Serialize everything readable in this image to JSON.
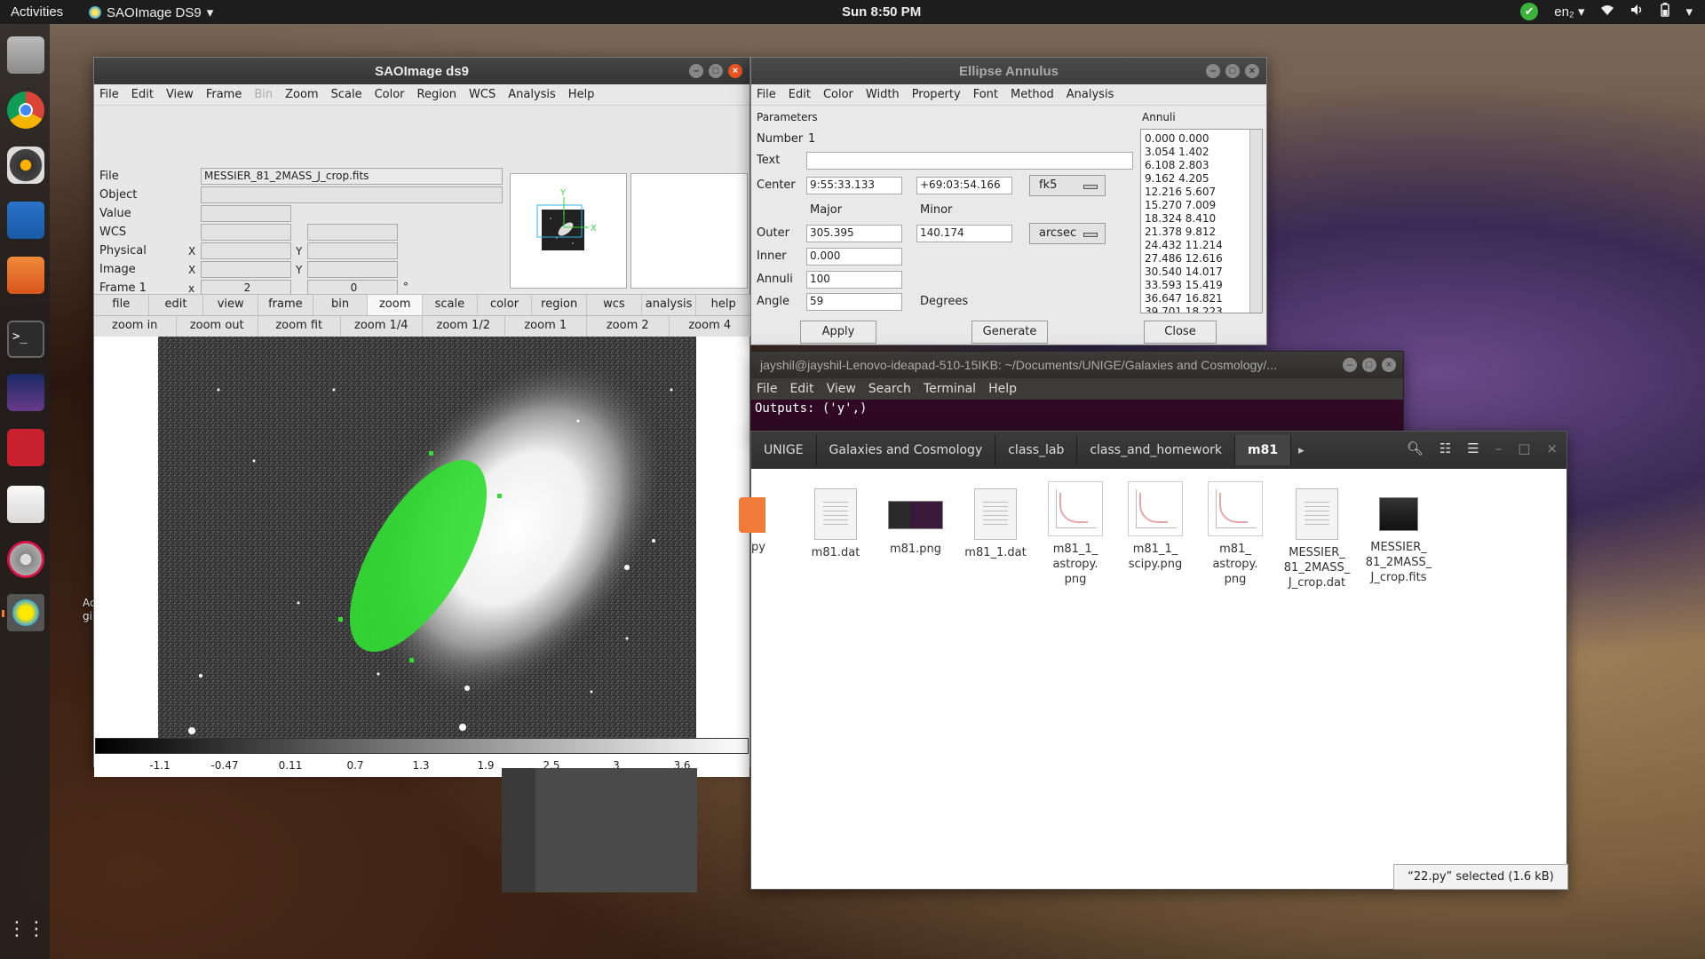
{
  "topbar": {
    "activities": "Activities",
    "app_name": "SAOImage DS9",
    "app_menu_arrow": "▾",
    "clock": "Sun  8:50 PM",
    "lang": "en₂",
    "lang_arrow": "▾"
  },
  "dock": {
    "items": [
      "files-icon",
      "chrome-icon",
      "rhythmbox-icon",
      "writer-icon",
      "software-center-icon",
      "terminal-icon",
      "stellarium-icon",
      "mendeley-icon",
      "text-editor-icon",
      "settings-icon",
      "ds9-icon"
    ],
    "show_apps": "show-applications-icon"
  },
  "desktop": {
    "partial_label": "Ac\ngi"
  },
  "ds9": {
    "title": "SAOImage ds9",
    "menu": [
      "File",
      "Edit",
      "View",
      "Frame",
      "Bin",
      "Zoom",
      "Scale",
      "Color",
      "Region",
      "WCS",
      "Analysis",
      "Help"
    ],
    "info": {
      "file_label": "File",
      "file_value": "MESSIER_81_2MASS_J_crop.fits",
      "object_label": "Object",
      "value_label": "Value",
      "wcs_label": "WCS",
      "physical_label": "Physical",
      "image_label": "Image",
      "frame_label": "Frame 1",
      "x_label": "X",
      "y_label": "Y",
      "frame_x_label": "x",
      "frame_zoom": "2",
      "frame_angle": "0",
      "degree_symbol": "°"
    },
    "panner": {
      "x_axis": "X",
      "y_axis": "Y"
    },
    "buttonbar_main": [
      "file",
      "edit",
      "view",
      "frame",
      "bin",
      "zoom",
      "scale",
      "color",
      "region",
      "wcs",
      "analysis",
      "help"
    ],
    "buttonbar_main_selected": "zoom",
    "buttonbar_zoom": [
      "zoom in",
      "zoom out",
      "zoom fit",
      "zoom 1/4",
      "zoom 1/2",
      "zoom 1",
      "zoom 2",
      "zoom 4"
    ],
    "colorbar_ticks": [
      "-1.1",
      "-0.47",
      "0.11",
      "0.7",
      "1.3",
      "1.9",
      "2.5",
      "3",
      "3.6"
    ],
    "region_color": "#33dd33"
  },
  "ellipse": {
    "title": "Ellipse Annulus",
    "menu": [
      "File",
      "Edit",
      "Color",
      "Width",
      "Property",
      "Font",
      "Method",
      "Analysis"
    ],
    "parameters_title": "Parameters",
    "annuli_title": "Annuli",
    "number_label": "Number",
    "number_value": "1",
    "text_label": "Text",
    "text_value": "",
    "center_label": "Center",
    "center_ra": "9:55:33.133",
    "center_dec": "+69:03:54.166",
    "center_system": "fk5",
    "major_label": "Major",
    "minor_label": "Minor",
    "outer_label": "Outer",
    "outer_major": "305.395",
    "outer_minor": "140.174",
    "outer_units": "arcsec",
    "inner_label": "Inner",
    "inner_value": "0.000",
    "annuli_label": "Annuli",
    "annuli_value": "100",
    "angle_label": "Angle",
    "angle_value": "59",
    "angle_units": "Degrees",
    "annuli_list": [
      "0.000 0.000",
      "3.054 1.402",
      "6.108 2.803",
      "9.162 4.205",
      "12.216 5.607",
      "15.270 7.009",
      "18.324 8.410",
      "21.378 9.812",
      "24.432 11.214",
      "27.486 12.616",
      "30.540 14.017",
      "33.593 15.419",
      "36.647 16.821",
      "39.701 18.223"
    ],
    "apply": "Apply",
    "generate": "Generate",
    "close": "Close"
  },
  "terminal": {
    "title": "jayshil@jayshil-Lenovo-ideapad-510-15IKB: ~/Documents/UNIGE/Galaxies and Cosmology/...",
    "menu": [
      "File",
      "Edit",
      "View",
      "Search",
      "Terminal",
      "Help"
    ],
    "output": "Outputs: ('y',)"
  },
  "files": {
    "breadcrumbs": [
      "UNIGE",
      "Galaxies and Cosmology",
      "class_lab",
      "class_and_homework",
      "m81"
    ],
    "current": "m81",
    "items": [
      {
        "name": "py",
        "kind": "python"
      },
      {
        "name": "m81.dat",
        "kind": "doc"
      },
      {
        "name": "m81.png",
        "kind": "image"
      },
      {
        "name": "m81_1.dat",
        "kind": "doc"
      },
      {
        "name": "m81_1_\nastropy.\npng",
        "kind": "plot"
      },
      {
        "name": "m81_1_\nscipy.png",
        "kind": "plot"
      },
      {
        "name": "m81_\nastropy.\npng",
        "kind": "plot"
      },
      {
        "name": "MESSIER_\n81_2MASS_\nJ_crop.dat",
        "kind": "doc"
      },
      {
        "name": "MESSIER_\n81_2MASS_\nJ_crop.fits",
        "kind": "fits"
      }
    ],
    "status": "“22.py” selected  (1.6 kB)"
  }
}
